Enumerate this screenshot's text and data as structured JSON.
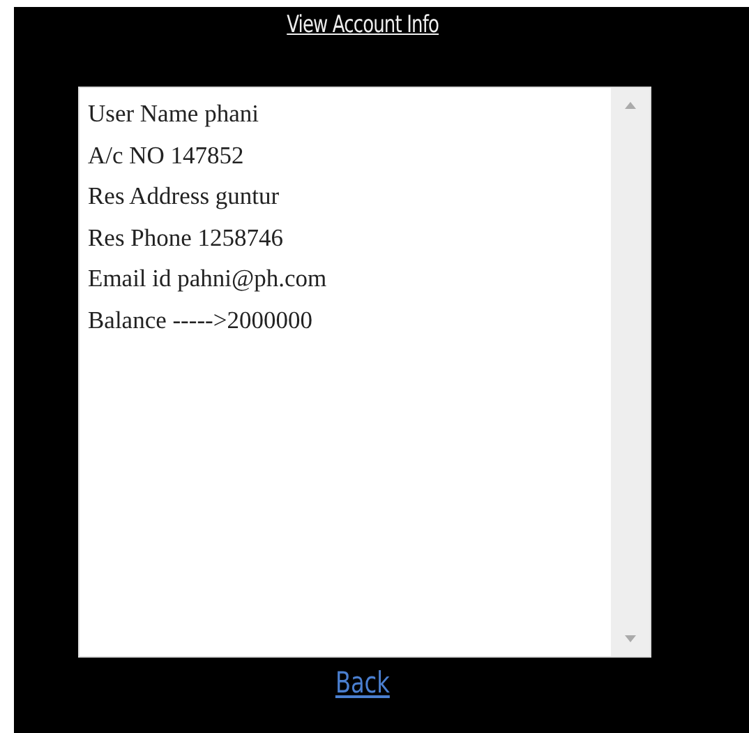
{
  "title": "View Account Info",
  "info_lines": [
    "User Name phani",
    "A/c NO 147852",
    "Res Address guntur",
    "Res Phone 1258746",
    "Email id pahni@ph.com",
    "Balance ----->2000000"
  ],
  "back_link": "Back"
}
